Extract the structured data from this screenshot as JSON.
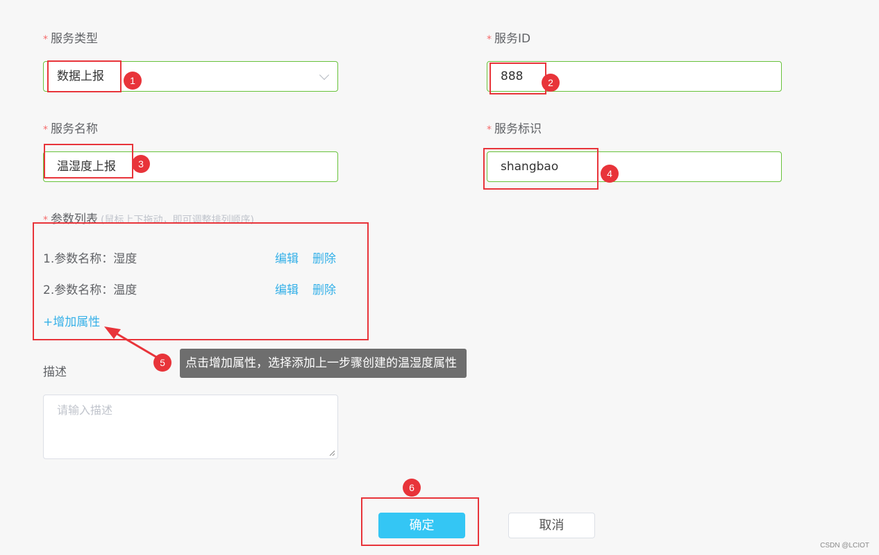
{
  "form": {
    "service_type": {
      "label": "服务类型",
      "value": "数据上报"
    },
    "service_id": {
      "label": "服务ID",
      "value": "888"
    },
    "service_name": {
      "label": "服务名称",
      "value": "温湿度上报"
    },
    "service_identifier": {
      "label": "服务标识",
      "value": "shangbao"
    },
    "param_list": {
      "label": "参数列表",
      "hint": "(鼠标上下拖动，即可调整排列顺序)",
      "items": [
        {
          "text": "1.参数名称：湿度",
          "edit": "编辑",
          "delete": "删除"
        },
        {
          "text": "2.参数名称：温度",
          "edit": "编辑",
          "delete": "删除"
        }
      ],
      "add_label": "+增加属性"
    },
    "description": {
      "label": "描述",
      "placeholder": "请输入描述"
    },
    "required_mark": "*"
  },
  "buttons": {
    "confirm": "确定",
    "cancel": "取消"
  },
  "annotations": {
    "badges": [
      "1",
      "2",
      "3",
      "4",
      "5",
      "6"
    ],
    "tooltip": "点击增加属性，选择添加上一步骤创建的温湿度属性"
  },
  "watermark": "CSDN @LCIOT",
  "colors": {
    "valid_border": "#67c23a",
    "primary": "#34c6f4",
    "link": "#35b0e8",
    "annotation_red": "#e8343a"
  }
}
